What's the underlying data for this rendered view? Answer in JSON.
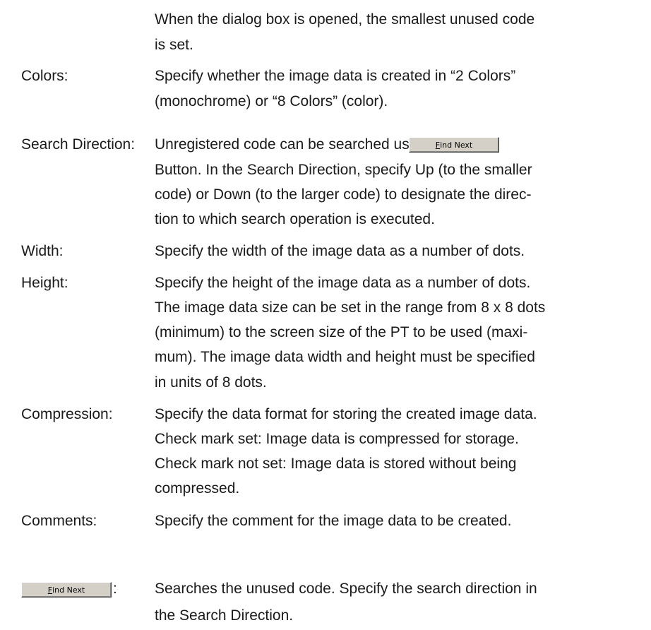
{
  "intro": {
    "line1": "When the dialog box is opened, the smallest unused code",
    "line2": "is set."
  },
  "items": [
    {
      "term": "Colors:",
      "lines": [
        "Specify whether the image data is created in “2 Colors”",
        "(monochrome) or “8 Colors” (color)."
      ]
    },
    {
      "term": "Search Direction:",
      "lines": [
        "Unregistered code can be searched using the",
        "Button. In the Search Direction, specify Up (to the smaller",
        "code) or Down (to the larger code) to designate the direc-",
        "tion to which search operation is executed."
      ]
    },
    {
      "term": "Width:",
      "lines": [
        "Specify the width of the image data as a number of dots."
      ]
    },
    {
      "term": "Height:",
      "lines": [
        "Specify the height of the image data as a number of dots.",
        "The image data size can be set in the range from 8 x 8 dots",
        "(minimum) to the screen size of the PT to be used (maxi-",
        "mum). The image data width and height must be specified",
        "in units of 8 dots."
      ]
    },
    {
      "term": "Compression:",
      "lines": [
        "Specify the data format for storing the created image data.",
        "Check mark set: Image data is compressed for storage.",
        "Check mark not set: Image data is stored without being",
        "compressed."
      ]
    },
    {
      "term": "Comments:",
      "lines": [
        "Specify the comment for the image data to be created."
      ]
    },
    {
      "term": ":",
      "lines": [
        "Searches the unused code. Specify the search direction in",
        "the Search Direction."
      ]
    }
  ],
  "find_next_button": {
    "mnemonic": "F",
    "rest": "ind Next"
  }
}
